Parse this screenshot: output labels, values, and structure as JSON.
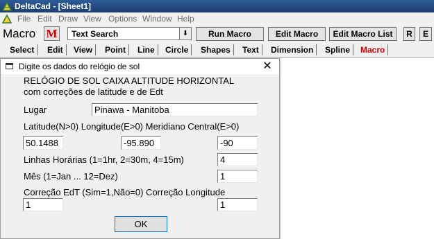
{
  "app": {
    "title": "DeltaCad - [Sheet1]",
    "accent": "#d00000",
    "titlebar_color": "#23497f"
  },
  "menu": {
    "items": [
      "File",
      "Edit",
      "Draw",
      "View",
      "Options",
      "Window",
      "Help"
    ]
  },
  "toolbar": {
    "mode_label": "Macro",
    "macro_icon_letter": "M",
    "macro_select_value": "Text Search",
    "buttons": {
      "run": "Run Macro",
      "edit": "Edit Macro",
      "list": "Edit Macro List",
      "r": "R",
      "e": "E"
    }
  },
  "tabs": [
    "Select",
    "Edit",
    "View",
    "Point",
    "Line",
    "Circle",
    "Shapes",
    "Text",
    "Dimension",
    "Spline",
    "Macro"
  ],
  "active_tab": "Macro",
  "dialog": {
    "title": "Digite os dados do relógio de sol",
    "heading1": "RELÓGIO DE SOL CAIXA ALTITUDE HORIZONTAL",
    "heading2": "com correções de latitude e de Edt",
    "place_label": "Lugar",
    "place_value": "Pinawa - Manitoba",
    "coords_label": "Latitude(N>0) Longitude(E>0) Meridiano Central(E>0)",
    "latitude": "50.1488",
    "longitude": "-95.890",
    "meridian": "-90",
    "hour_lines_label": "Linhas Horárias (1=1hr, 2=30m, 4=15m)",
    "hour_lines_value": "4",
    "month_label": "Mês (1=Jan ... 12=Dez)",
    "month_value": "1",
    "correction_label": "Correção EdT (Sim=1,Não=0) Correção Longitude",
    "edt_value": "1",
    "longitude_correction_value": "1",
    "ok_label": "OK"
  }
}
